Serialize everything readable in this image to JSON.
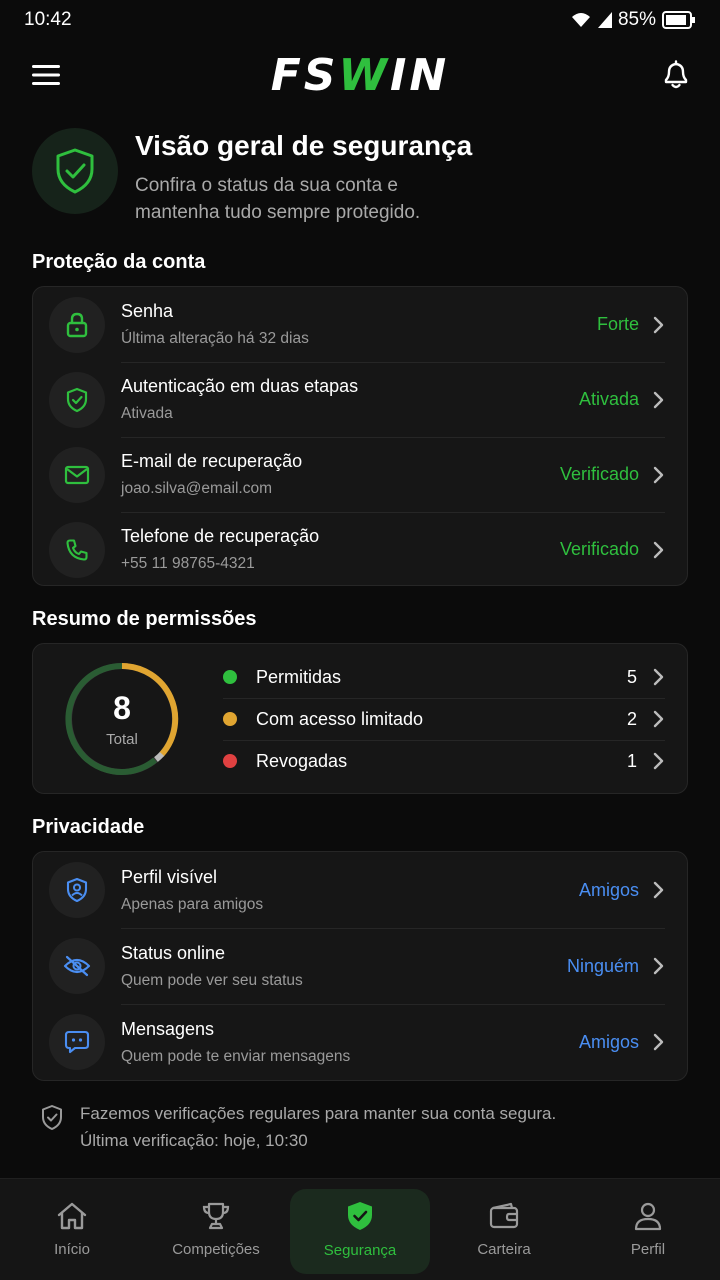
{
  "status_bar": {
    "time": "10:42",
    "battery": "85%"
  },
  "header": {
    "logo_prefix": "FS",
    "logo_accent": "W",
    "logo_suffix": "IN"
  },
  "hero": {
    "title": "Visão geral de segurança",
    "subtitle": "Confira o status da sua conta e mantenha tudo sempre protegido."
  },
  "account": {
    "title": "Proteção da conta",
    "items": [
      {
        "title": "Senha",
        "subtitle": "Última alteração há 32 dias",
        "value": "Forte",
        "icon": "lock-icon"
      },
      {
        "title": "Autenticação em duas etapas",
        "subtitle": "Ativada",
        "value": "Ativada",
        "icon": "shield-check-icon"
      },
      {
        "title": "E-mail de recuperação",
        "subtitle": "joao.silva@email.com",
        "value": "Verificado",
        "icon": "mail-icon"
      },
      {
        "title": "Telefone de recuperação",
        "subtitle": "+55 11 98765-4321",
        "value": "Verificado",
        "icon": "phone-icon"
      }
    ]
  },
  "permissions": {
    "title": "Resumo de permissões",
    "total": "8",
    "total_label": "Total",
    "items": [
      {
        "label": "Permitidas",
        "count": "5",
        "color": "#2fbf3e"
      },
      {
        "label": "Com acesso limitado",
        "count": "2",
        "color": "#e0a531"
      },
      {
        "label": "Revogadas",
        "count": "1",
        "color": "#e04141"
      }
    ]
  },
  "privacy": {
    "title": "Privacidade",
    "items": [
      {
        "title": "Perfil visível",
        "subtitle": "Apenas para amigos",
        "value": "Amigos",
        "icon": "user-shield-icon"
      },
      {
        "title": "Status online",
        "subtitle": "Quem pode ver seu status",
        "value": "Ninguém",
        "icon": "eye-off-icon"
      },
      {
        "title": "Mensagens",
        "subtitle": "Quem pode te enviar mensagens",
        "value": "Amigos",
        "icon": "message-icon"
      }
    ]
  },
  "footer": {
    "line1": "Fazemos verificações regulares para manter sua conta segura.",
    "line2": "Última verificação: hoje, 10:30"
  },
  "nav": [
    {
      "label": "Início",
      "icon": "home-icon"
    },
    {
      "label": "Competições",
      "icon": "trophy-icon"
    },
    {
      "label": "Segurança",
      "icon": "shield-icon",
      "active": true
    },
    {
      "label": "Carteira",
      "icon": "wallet-icon"
    },
    {
      "label": "Perfil",
      "icon": "user-icon"
    }
  ],
  "colors": {
    "accent": "#2fbf3e",
    "link": "#4a8ef2",
    "warning": "#e0a531",
    "danger": "#e04141"
  }
}
